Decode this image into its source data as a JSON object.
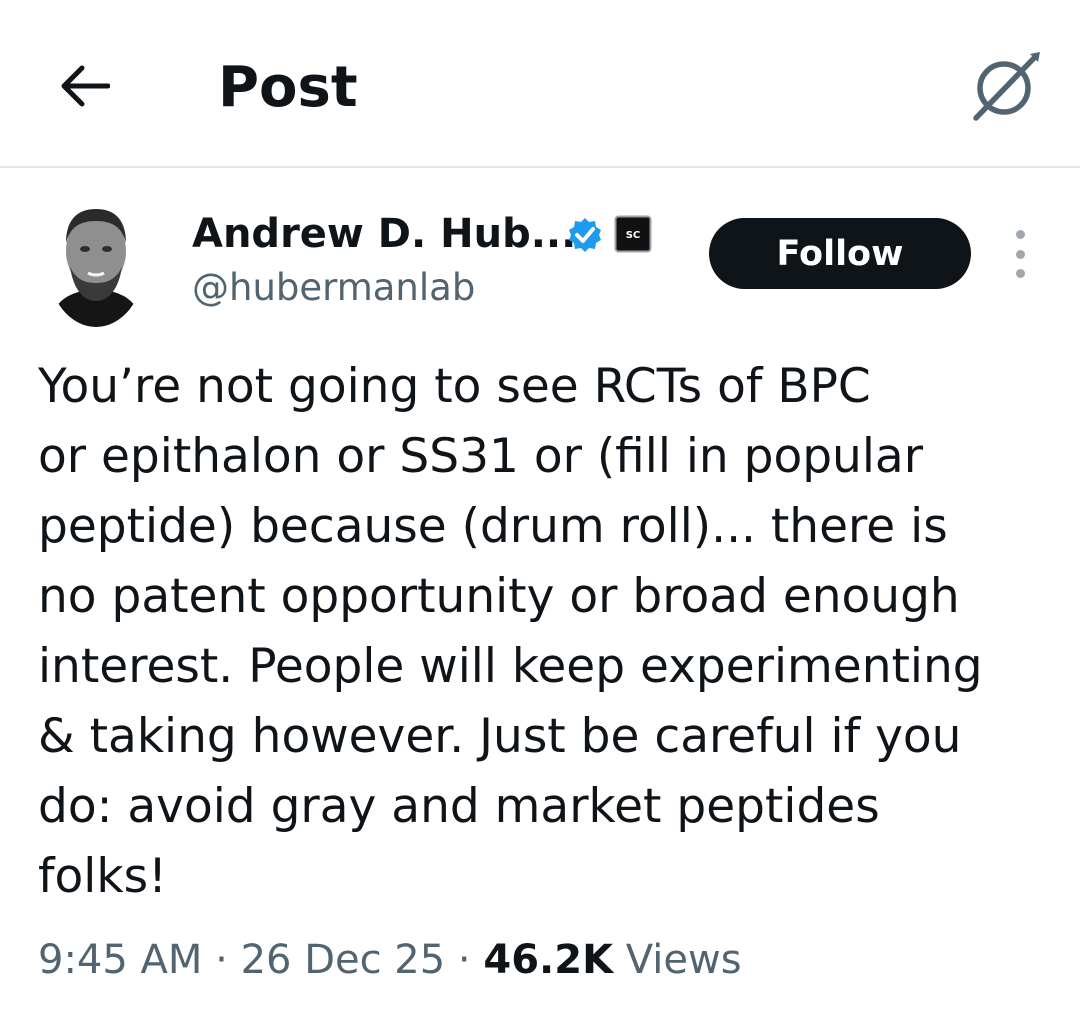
{
  "header": {
    "title": "Post",
    "back_icon": "arrow-left-icon",
    "grok_icon": "grok-icon"
  },
  "author": {
    "name": "Andrew D. Hub...",
    "handle": "@hubermanlab",
    "verified_color": "#1d9bf0",
    "affiliate_badge_text": "SC"
  },
  "follow_button": {
    "label": "Follow"
  },
  "post": {
    "text": "You’re not going to see RCTs of BPC\nor epithalon or SS31 or (fill in popular\npeptide) because (drum roll)... there is\nno patent opportunity or broad enough\ninterest. People will keep experimenting\n& taking however. Just be careful if you\ndo: avoid gray and market peptides\nfolks!"
  },
  "meta": {
    "time": "9:45 AM",
    "separator": " · ",
    "date": "26 Dec 25",
    "views_count": "46.2K",
    "views_label": " Views"
  },
  "colors": {
    "text_primary": "#0f1419",
    "text_secondary": "#536471",
    "divider": "#e5e7e9",
    "follow_bg": "#0f1419"
  }
}
